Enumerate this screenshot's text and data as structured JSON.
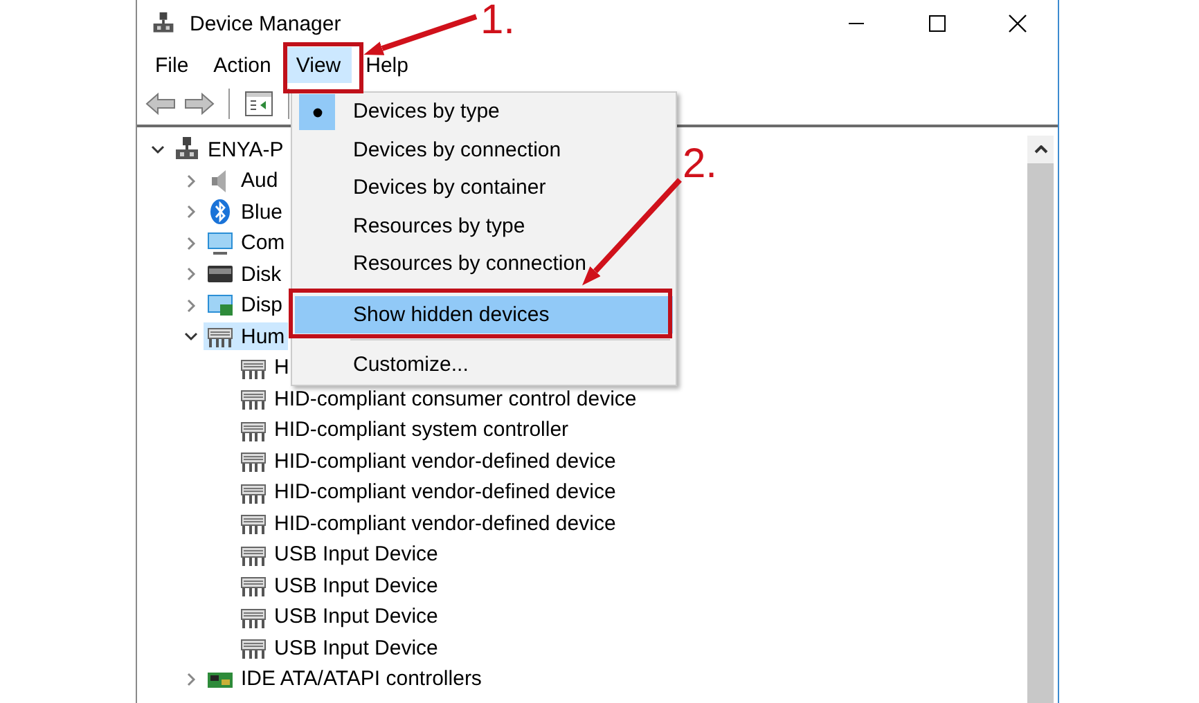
{
  "window": {
    "title": "Device Manager"
  },
  "menu_bar": [
    {
      "label": "File",
      "selected": false
    },
    {
      "label": "Action",
      "selected": false
    },
    {
      "label": "View",
      "selected": true
    },
    {
      "label": "Help",
      "selected": false
    }
  ],
  "tree": [
    {
      "label": "ENYA-P",
      "kind": "computer",
      "expanded": true,
      "selected": false,
      "children": [
        {
          "label": "Aud",
          "kind": "audio",
          "expanded": false,
          "selected": false
        },
        {
          "label": "Blue",
          "kind": "bluetooth",
          "expanded": false,
          "selected": false
        },
        {
          "label": "Com",
          "kind": "monitor",
          "expanded": false,
          "selected": false
        },
        {
          "label": "Disk",
          "kind": "disk",
          "expanded": false,
          "selected": false
        },
        {
          "label": "Disp",
          "kind": "display",
          "expanded": false,
          "selected": false
        },
        {
          "label": "Hum",
          "kind": "hid",
          "expanded": true,
          "selected": true,
          "children": [
            {
              "label": "H",
              "kind": "hid",
              "selected": false
            },
            {
              "label": "HID-compliant consumer control device",
              "kind": "hid",
              "selected": false
            },
            {
              "label": "HID-compliant system controller",
              "kind": "hid",
              "selected": false
            },
            {
              "label": "HID-compliant vendor-defined device",
              "kind": "hid",
              "selected": false
            },
            {
              "label": "HID-compliant vendor-defined device",
              "kind": "hid",
              "selected": false
            },
            {
              "label": "HID-compliant vendor-defined device",
              "kind": "hid",
              "selected": false
            },
            {
              "label": "USB Input Device",
              "kind": "hid",
              "selected": false
            },
            {
              "label": "USB Input Device",
              "kind": "hid",
              "selected": false
            },
            {
              "label": "USB Input Device",
              "kind": "hid",
              "selected": false
            },
            {
              "label": "USB Input Device",
              "kind": "hid",
              "selected": false
            }
          ]
        },
        {
          "label": "IDE ATA/ATAPI controllers",
          "kind": "ide",
          "expanded": false,
          "selected": false
        }
      ]
    }
  ],
  "view_menu": [
    {
      "kind": "radio",
      "label": "Devices by type",
      "checked": true,
      "highlighted": false
    },
    {
      "kind": "radio",
      "label": "Devices by connection",
      "checked": false,
      "highlighted": false
    },
    {
      "kind": "radio",
      "label": "Devices by container",
      "checked": false,
      "highlighted": false
    },
    {
      "kind": "radio",
      "label": "Resources by type",
      "checked": false,
      "highlighted": false
    },
    {
      "kind": "radio",
      "label": "Resources by connection",
      "checked": false,
      "highlighted": false
    },
    {
      "kind": "separator"
    },
    {
      "kind": "command",
      "label": "Show hidden devices",
      "highlighted": true
    },
    {
      "kind": "separator"
    },
    {
      "kind": "command",
      "label": "Customize...",
      "highlighted": false
    }
  ],
  "annotations": [
    {
      "label": "1."
    },
    {
      "label": "2."
    }
  ]
}
